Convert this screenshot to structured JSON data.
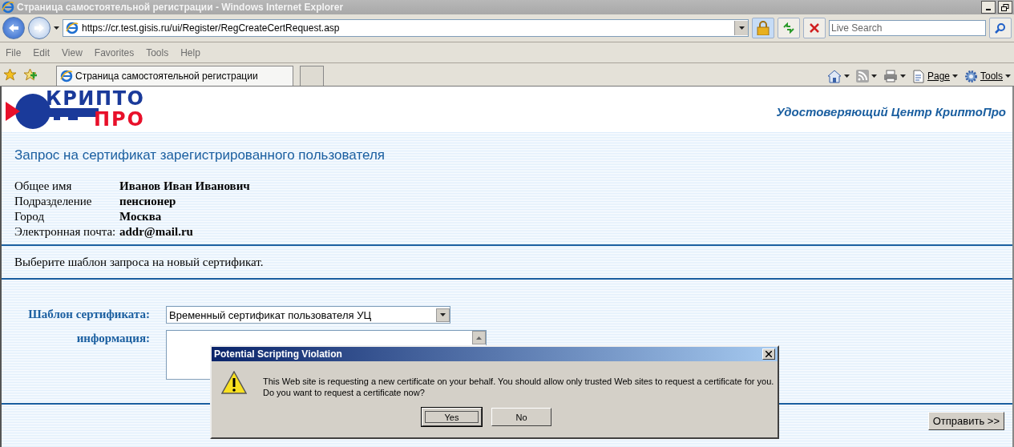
{
  "window": {
    "title": "Страница самостоятельной регистрации - Windows Internet Explorer"
  },
  "address_bar": {
    "url": "https://cr.test.gisis.ru/ui/Register/RegCreateCertRequest.asp"
  },
  "search": {
    "placeholder": "Live Search"
  },
  "menu": [
    "File",
    "Edit",
    "View",
    "Favorites",
    "Tools",
    "Help"
  ],
  "tabs": [
    {
      "label": "Страница самостоятельной регистрации",
      "selected": true
    }
  ],
  "command_bar": [
    {
      "kind": "home"
    },
    {
      "kind": "feed"
    },
    {
      "kind": "print"
    },
    {
      "kind": "page",
      "label": "Page"
    },
    {
      "kind": "tools",
      "label": "Tools"
    }
  ],
  "page": {
    "logo": {
      "line1": "КРИПТО",
      "line2": "ПРО"
    },
    "header_title": "Удостоверяющий Центр КриптоПро",
    "heading": "Запрос на сертификат зарегистрированного пользователя",
    "info": [
      {
        "label": "Общее имя",
        "value": "Иванов Иван Иванович"
      },
      {
        "label": "Подразделение",
        "value": "пенсионер"
      },
      {
        "label": "Город",
        "value": "Москва"
      },
      {
        "label": "Электронная почта:",
        "value": "addr@mail.ru"
      }
    ],
    "instruction": "Выберите шаблон запроса на новый сертификат.",
    "form": {
      "template_label": "Шаблон сертификата:",
      "template_value": "Временный сертификат пользователя УЦ",
      "info_label": "информация:"
    },
    "submit": "Отправить >>"
  },
  "dialog": {
    "title": "Potential Scripting Violation",
    "message": [
      "This Web site is requesting a new certificate on your behalf. You should allow only trusted Web sites to request a certificate for you.",
      "Do you want to request a certificate now?"
    ],
    "buttons": [
      {
        "label": "Yes",
        "selected": true
      },
      {
        "label": "No",
        "selected": false
      }
    ]
  }
}
